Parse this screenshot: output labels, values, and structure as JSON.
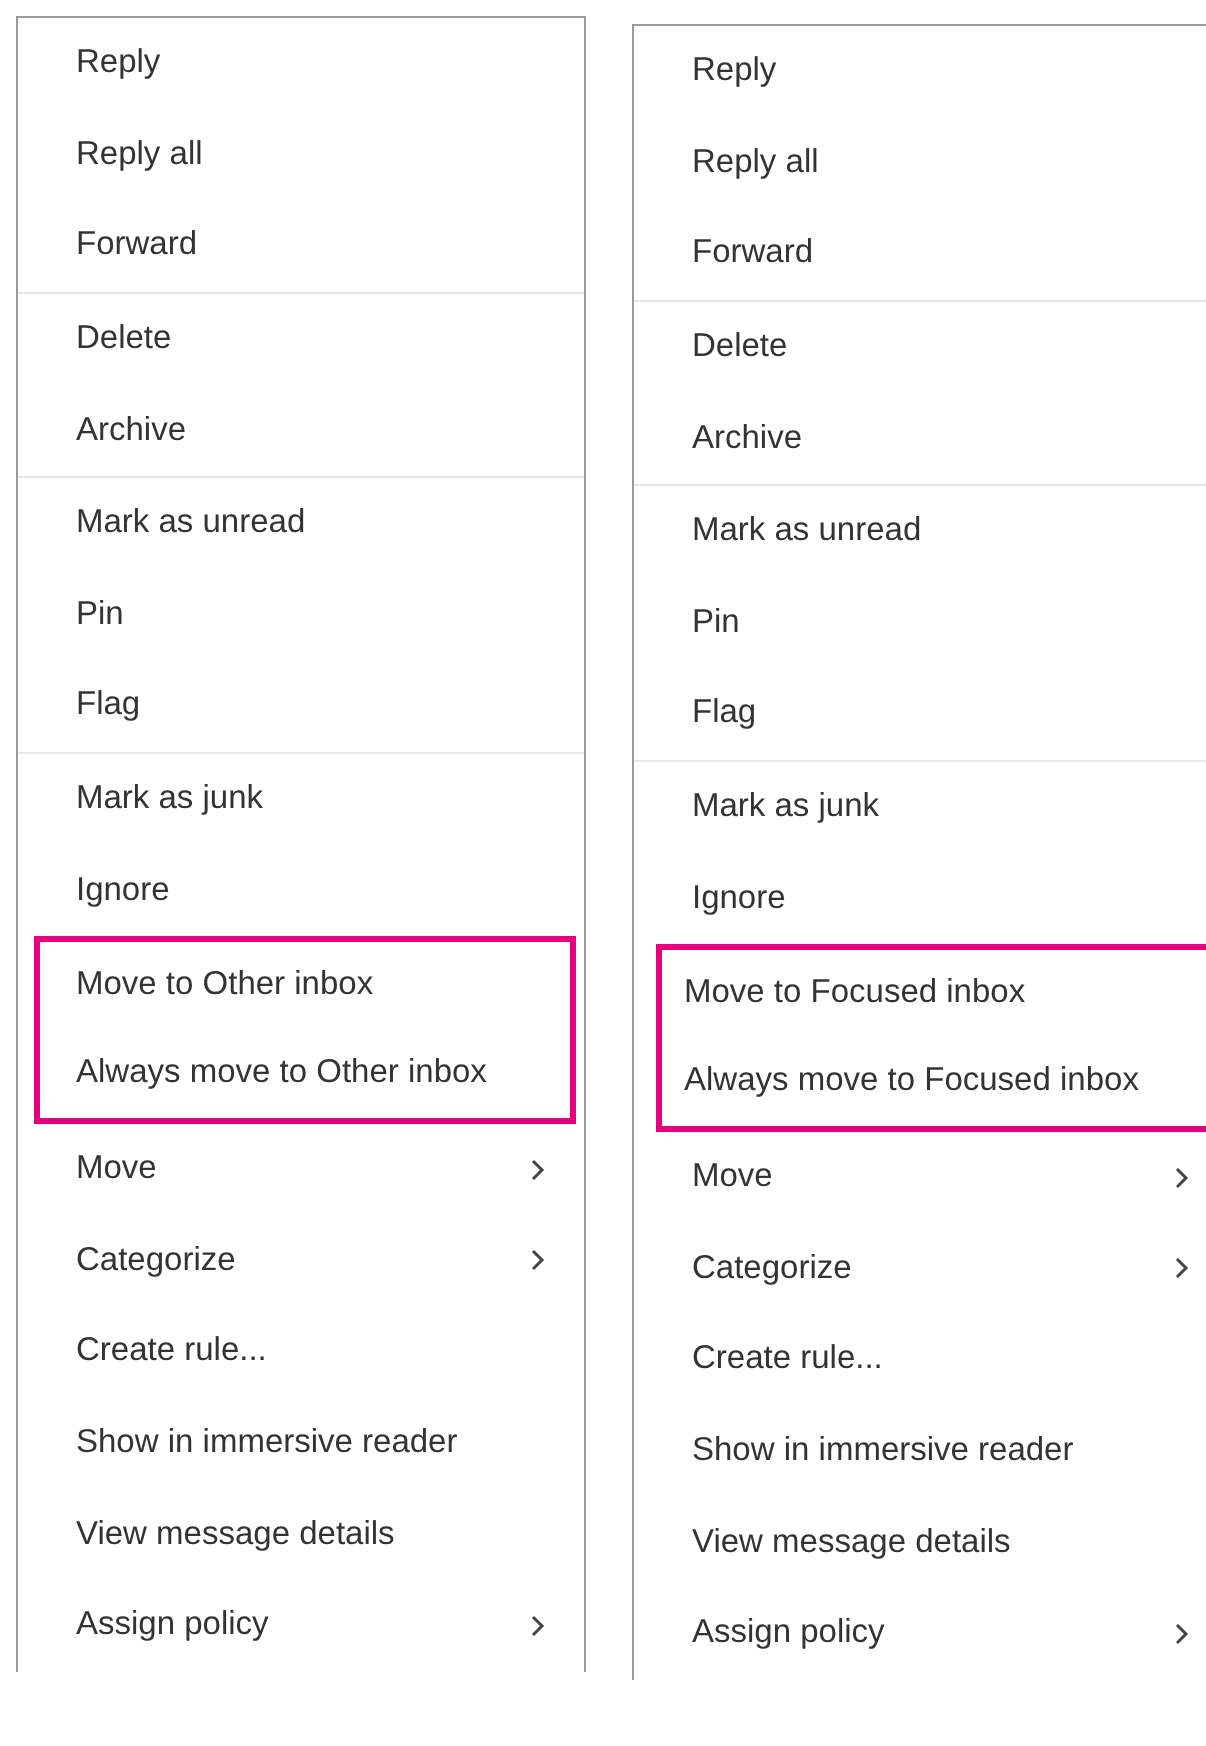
{
  "menus": [
    {
      "groups": [
        {
          "highlighted": false,
          "items": [
            {
              "label": "Reply",
              "submenu": false
            },
            {
              "label": "Reply all",
              "submenu": false
            },
            {
              "label": "Forward",
              "submenu": false
            }
          ]
        },
        {
          "highlighted": false,
          "items": [
            {
              "label": "Delete",
              "submenu": false
            },
            {
              "label": "Archive",
              "submenu": false
            }
          ]
        },
        {
          "highlighted": false,
          "items": [
            {
              "label": "Mark as unread",
              "submenu": false
            },
            {
              "label": "Pin",
              "submenu": false
            },
            {
              "label": "Flag",
              "submenu": false
            }
          ]
        },
        {
          "highlighted": false,
          "items": [
            {
              "label": "Mark as junk",
              "submenu": false
            },
            {
              "label": "Ignore",
              "submenu": false
            }
          ]
        },
        {
          "highlighted": true,
          "items": [
            {
              "label": "Move to Other inbox",
              "submenu": false
            },
            {
              "label": "Always move to Other inbox",
              "submenu": false
            }
          ]
        },
        {
          "highlighted": false,
          "items": [
            {
              "label": "Move",
              "submenu": true
            },
            {
              "label": "Categorize",
              "submenu": true
            },
            {
              "label": "Create rule...",
              "submenu": false
            },
            {
              "label": "Show in immersive reader",
              "submenu": false
            },
            {
              "label": "View message details",
              "submenu": false
            },
            {
              "label": "Assign policy",
              "submenu": true
            }
          ]
        }
      ]
    },
    {
      "groups": [
        {
          "highlighted": false,
          "items": [
            {
              "label": "Reply",
              "submenu": false
            },
            {
              "label": "Reply all",
              "submenu": false
            },
            {
              "label": "Forward",
              "submenu": false
            }
          ]
        },
        {
          "highlighted": false,
          "items": [
            {
              "label": "Delete",
              "submenu": false
            },
            {
              "label": "Archive",
              "submenu": false
            }
          ]
        },
        {
          "highlighted": false,
          "items": [
            {
              "label": "Mark as unread",
              "submenu": false
            },
            {
              "label": "Pin",
              "submenu": false
            },
            {
              "label": "Flag",
              "submenu": false
            }
          ]
        },
        {
          "highlighted": false,
          "items": [
            {
              "label": "Mark as junk",
              "submenu": false
            },
            {
              "label": "Ignore",
              "submenu": false
            }
          ]
        },
        {
          "highlighted": true,
          "items": [
            {
              "label": "Move to Focused inbox",
              "submenu": false
            },
            {
              "label": "Always move to Focused inbox",
              "submenu": false
            }
          ]
        },
        {
          "highlighted": false,
          "items": [
            {
              "label": "Move",
              "submenu": true
            },
            {
              "label": "Categorize",
              "submenu": true
            },
            {
              "label": "Create rule...",
              "submenu": false
            },
            {
              "label": "Show in immersive reader",
              "submenu": false
            },
            {
              "label": "View message details",
              "submenu": false
            },
            {
              "label": "Assign policy",
              "submenu": true
            }
          ]
        }
      ]
    }
  ]
}
